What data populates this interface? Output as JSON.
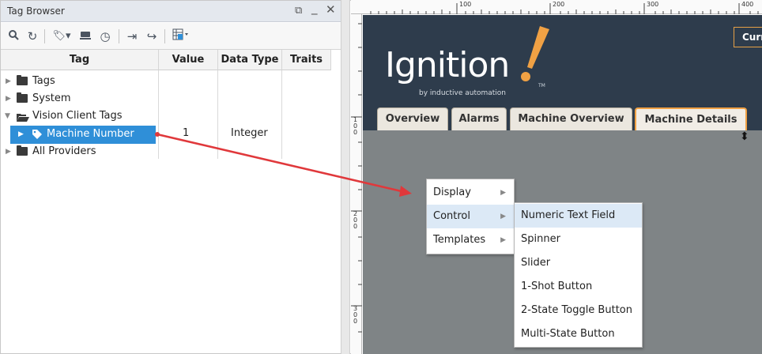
{
  "tag_browser": {
    "title": "Tag Browser",
    "window_controls": [
      "restore-icon",
      "minimize-icon",
      "close-icon"
    ],
    "toolbar_icons": [
      "search-icon",
      "refresh-icon",
      "add-tag-icon",
      "database-icon",
      "history-icon",
      "import-icon",
      "export-icon",
      "view-grid-icon"
    ],
    "columns": {
      "tag": "Tag",
      "value": "Value",
      "data_type": "Data Type",
      "traits": "Traits"
    },
    "tree": [
      {
        "label": "Tags",
        "level": 0,
        "expanded": false,
        "icon": "folder-icon"
      },
      {
        "label": "System",
        "level": 0,
        "expanded": false,
        "icon": "folder-icon"
      },
      {
        "label": "Vision Client Tags",
        "level": 0,
        "expanded": true,
        "icon": "folder-open-icon"
      },
      {
        "label": "Machine Number",
        "level": 1,
        "expanded": false,
        "icon": "tag-icon",
        "selected": true,
        "value": "1",
        "data_type": "Integer"
      },
      {
        "label": "All Providers",
        "level": 0,
        "expanded": false,
        "icon": "folder-icon"
      }
    ]
  },
  "designer": {
    "ruler_labels": [
      "100",
      "200",
      "300",
      "400"
    ],
    "ruler_left_labels": [
      "1\n0\n0",
      "2\n0\n0",
      "3\n0\n0"
    ],
    "logo": {
      "main": "Ignition",
      "sub": "by inductive automation",
      "tm": "TM"
    },
    "current_button": "Curr",
    "tabs": [
      {
        "label": "Overview",
        "active": false
      },
      {
        "label": "Alarms",
        "active": false
      },
      {
        "label": "Machine Overview",
        "active": false
      },
      {
        "label": "Machine Details",
        "active": true
      }
    ]
  },
  "context_menu": {
    "items": [
      "Display",
      "Control",
      "Templates"
    ],
    "highlighted": "Control",
    "submenu": [
      "Numeric Text Field",
      "Spinner",
      "Slider",
      "1-Shot Button",
      "2-State Toggle Button",
      "Multi-State Button"
    ],
    "submenu_highlighted": "Numeric Text Field"
  },
  "colors": {
    "selection": "#2f8fd8",
    "header_bg": "#2e3c4c",
    "accent_orange": "#f0a144",
    "drag_arrow": "#e0383b",
    "canvas_bg": "#7f8486"
  }
}
